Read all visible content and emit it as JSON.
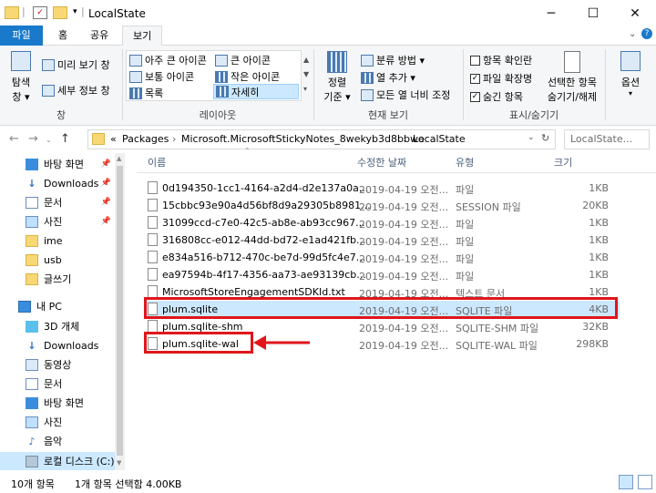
{
  "window": {
    "title": "LocalState",
    "minimize": "─",
    "maximize": "☐",
    "close": "✕"
  },
  "ribbon_tabs": [
    "파일",
    "홈",
    "공유",
    "보기"
  ],
  "ribbon": {
    "pane": {
      "nav_pane": "탐색",
      "nav_pane2": "창 ▾",
      "preview": "미리 보기 창",
      "details": "세부 정보 창",
      "label": "창"
    },
    "layout": {
      "items": [
        "아주 큰 아이콘",
        "큰 아이콘",
        "보통 아이콘",
        "작은 아이콘",
        "목록",
        "자세히"
      ],
      "label": "레이아웃"
    },
    "current_view": {
      "sort": "정렬",
      "sort2": "기준 ▾",
      "group_by": "분류 방법 ▾",
      "add_column": "열 추가 ▾",
      "fit_columns": "모든 열 너비 조정",
      "label": "현재 보기"
    },
    "show_hide": {
      "checkboxes": "항목 확인란",
      "extensions": "파일 확장명",
      "hidden": "숨긴 항목",
      "hide_selected": "선택한 항목",
      "hide_selected2": "숨기기/해제",
      "label": "표시/숨기기"
    },
    "options": "옵션"
  },
  "address": {
    "prefix": "«",
    "crumbs": [
      "Packages",
      "Microsoft.MicrosoftStickyNotes_8wekyb3d8bbwe",
      "LocalState"
    ],
    "search_placeholder": "LocalState..."
  },
  "sidebar": {
    "quick": [
      {
        "label": "바탕 화면",
        "pinned": true
      },
      {
        "label": "Downloads",
        "pinned": true
      },
      {
        "label": "문서",
        "pinned": true
      },
      {
        "label": "사진",
        "pinned": true
      },
      {
        "label": "ime",
        "pinned": false
      },
      {
        "label": "usb",
        "pinned": false
      },
      {
        "label": "글쓰기",
        "pinned": false
      }
    ],
    "this_pc": "내 PC",
    "pc_items": [
      "3D 개체",
      "Downloads",
      "동영상",
      "문서",
      "바탕 화면",
      "사진",
      "음악",
      "로컬 디스크 (C:)"
    ]
  },
  "columns": {
    "name": "이름",
    "date": "수정한 날짜",
    "type": "유형",
    "size": "크기"
  },
  "files": [
    {
      "name": "0d194350-1cc1-4164-a2d4-d2e137a0a...",
      "date": "2019-04-19 오전...",
      "type": "파일",
      "size": "1KB"
    },
    {
      "name": "15cbbc93e90a4d56bf8d9a29305b8981...",
      "date": "2019-04-19 오전...",
      "type": "SESSION 파일",
      "size": "20KB"
    },
    {
      "name": "31099ccd-c7e0-42c5-ab8e-ab93cc967...",
      "date": "2019-04-19 오전...",
      "type": "파일",
      "size": "1KB"
    },
    {
      "name": "316808cc-e012-44dd-bd72-e1ad421fb...",
      "date": "2019-04-19 오전...",
      "type": "파일",
      "size": "1KB"
    },
    {
      "name": "e834a516-b712-470c-be7d-99d5fc4e7...",
      "date": "2019-04-19 오전...",
      "type": "파일",
      "size": "1KB"
    },
    {
      "name": "ea97594b-4f17-4356-aa73-ae93139cb...",
      "date": "2019-04-19 오전...",
      "type": "파일",
      "size": "1KB"
    },
    {
      "name": "MicrosoftStoreEngagementSDKId.txt",
      "date": "2019-04-19 오전...",
      "type": "텍스트 문서",
      "size": "1KB"
    },
    {
      "name": "plum.sqlite",
      "date": "2019-04-19 오전...",
      "type": "SQLITE 파일",
      "size": "4KB"
    },
    {
      "name": "plum.sqlite-shm",
      "date": "2019-04-19 오전...",
      "type": "SQLITE-SHM 파일",
      "size": "32KB"
    },
    {
      "name": "plum.sqlite-wal",
      "date": "2019-04-19 오전...",
      "type": "SQLITE-WAL 파일",
      "size": "298KB"
    }
  ],
  "status": {
    "count": "10개 항목",
    "selected": "1개 항목 선택함 4.00KB"
  },
  "colors": {
    "accent": "#1979ca",
    "selection": "#cce8ff",
    "highlight": "#e0161b"
  }
}
